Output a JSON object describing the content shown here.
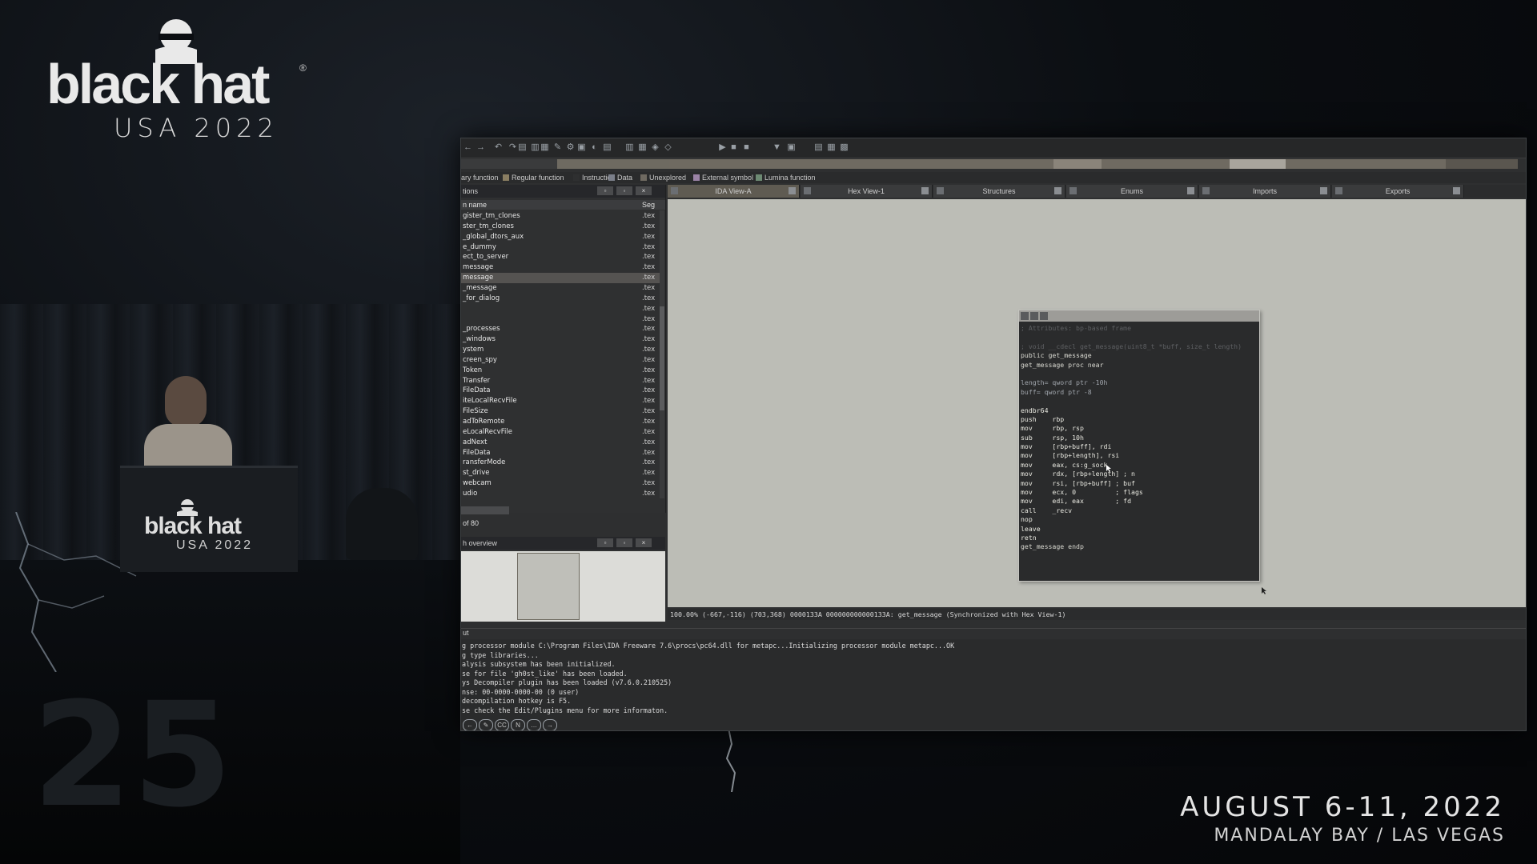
{
  "branding": {
    "logo_word": "black hat",
    "logo_reg": "®",
    "logo_sub": "USA 2022",
    "podium_word": "black hat",
    "podium_sub": "USA 2022",
    "anniversary": "25",
    "date": "AUGUST 6-11, 2022",
    "venue": "MANDALAY BAY / LAS VEGAS"
  },
  "ida": {
    "legend": [
      "ary function",
      "Regular function",
      "Instruction",
      "Data",
      "Unexplored",
      "External symbol",
      "Lumina function"
    ],
    "legend_colors": [
      "#4b4b4b",
      "#8a7e62",
      "#2e2f30",
      "#7b7f8a",
      "#6f6a61",
      "#9b83a6",
      "#6d8a73"
    ],
    "functions_panel": {
      "title": "tions",
      "col_name": "n name",
      "col_seg": "Seg",
      "rows": [
        {
          "name": "gister_tm_clones",
          "seg": ".tex"
        },
        {
          "name": "ster_tm_clones",
          "seg": ".tex"
        },
        {
          "name": "_global_dtors_aux",
          "seg": ".tex"
        },
        {
          "name": "e_dummy",
          "seg": ".tex"
        },
        {
          "name": "ect_to_server",
          "seg": ".tex"
        },
        {
          "name": "message",
          "seg": ".tex"
        },
        {
          "name": "message",
          "seg": ".tex"
        },
        {
          "name": "_message",
          "seg": ".tex"
        },
        {
          "name": "_for_dialog",
          "seg": ".tex"
        },
        {
          "name": "",
          "seg": ".tex"
        },
        {
          "name": "",
          "seg": ".tex"
        },
        {
          "name": "_processes",
          "seg": ".tex"
        },
        {
          "name": "_windows",
          "seg": ".tex"
        },
        {
          "name": "ystem",
          "seg": ".tex"
        },
        {
          "name": "creen_spy",
          "seg": ".tex"
        },
        {
          "name": "Token",
          "seg": ".tex"
        },
        {
          "name": "Transfer",
          "seg": ".tex"
        },
        {
          "name": "FileData",
          "seg": ".tex"
        },
        {
          "name": "iteLocalRecvFile",
          "seg": ".tex"
        },
        {
          "name": "FileSize",
          "seg": ".tex"
        },
        {
          "name": "adToRemote",
          "seg": ".tex"
        },
        {
          "name": "eLocalRecvFile",
          "seg": ".tex"
        },
        {
          "name": "adNext",
          "seg": ".tex"
        },
        {
          "name": "FileData",
          "seg": ".tex"
        },
        {
          "name": "ransferMode",
          "seg": ".tex"
        },
        {
          "name": "st_drive",
          "seg": ".tex"
        },
        {
          "name": "webcam",
          "seg": ".tex"
        },
        {
          "name": "udio",
          "seg": ".tex"
        }
      ],
      "selected_index": 6,
      "count": "of 80"
    },
    "overview_title": "h overview",
    "tabs": [
      {
        "label": "IDA View-A",
        "active": true
      },
      {
        "label": "Hex View-1",
        "active": false
      },
      {
        "label": "Structures",
        "active": false
      },
      {
        "label": "Enums",
        "active": false
      },
      {
        "label": "Imports",
        "active": false
      },
      {
        "label": "Exports",
        "active": false
      }
    ],
    "disasm": [
      {
        "cls": "c-cmt",
        "text": "; Attributes: bp-based frame"
      },
      {
        "cls": "c-cmt",
        "text": ""
      },
      {
        "cls": "c-cmt",
        "text": "; void __cdecl get_message(uint8_t *buff, size_t length)"
      },
      {
        "cls": "c-kw",
        "text": "public get_message"
      },
      {
        "cls": "c-kw",
        "text": "get_message proc near"
      },
      {
        "cls": "c-cmt",
        "text": ""
      },
      {
        "cls": "c-op",
        "text": "length= qword ptr -10h"
      },
      {
        "cls": "c-op",
        "text": "buff= qword ptr -8"
      },
      {
        "cls": "c-cmt",
        "text": ""
      },
      {
        "cls": "c-mn",
        "text": "endbr64"
      },
      {
        "cls": "c-mn",
        "text": "push    rbp"
      },
      {
        "cls": "c-mn",
        "text": "mov     rbp, rsp"
      },
      {
        "cls": "c-mn",
        "text": "sub     rsp, 10h"
      },
      {
        "cls": "c-mn",
        "text": "mov     [rbp+buff], rdi"
      },
      {
        "cls": "c-mn",
        "text": "mov     [rbp+length], rsi"
      },
      {
        "cls": "c-mn",
        "text": "mov     eax, cs:g_sock"
      },
      {
        "cls": "c-mn",
        "text": "mov     rdx, [rbp+length] ; n"
      },
      {
        "cls": "c-mn",
        "text": "mov     rsi, [rbp+buff] ; buf"
      },
      {
        "cls": "c-mn",
        "text": "mov     ecx, 0          ; flags"
      },
      {
        "cls": "c-mn",
        "text": "mov     edi, eax        ; fd"
      },
      {
        "cls": "c-mn",
        "text": "call    _recv"
      },
      {
        "cls": "c-mn",
        "text": "nop"
      },
      {
        "cls": "c-mn",
        "text": "leave"
      },
      {
        "cls": "c-mn",
        "text": "retn"
      },
      {
        "cls": "c-kw",
        "text": "get_message endp"
      }
    ],
    "status_line": "100.00% (-667,-116) (703,368) 0000133A 000000000000133A: get_message (Synchronized with Hex View-1)",
    "output_label": "ut",
    "output_lines": [
      "g processor module C:\\Program Files\\IDA Freeware 7.6\\procs\\pc64.dll for metapc...Initializing processor module metapc...OK",
      "g type libraries...",
      "alysis subsystem has been initialized.",
      "se for file 'gh0st_like' has been loaded.",
      "ys Decompiler plugin has been loaded (v7.6.0.210525)",
      "nse: 00-0000-0000-00 (0 user)",
      "decompilation hotkey is F5.",
      "se check the Edit/Plugins menu for more informaton."
    ]
  }
}
